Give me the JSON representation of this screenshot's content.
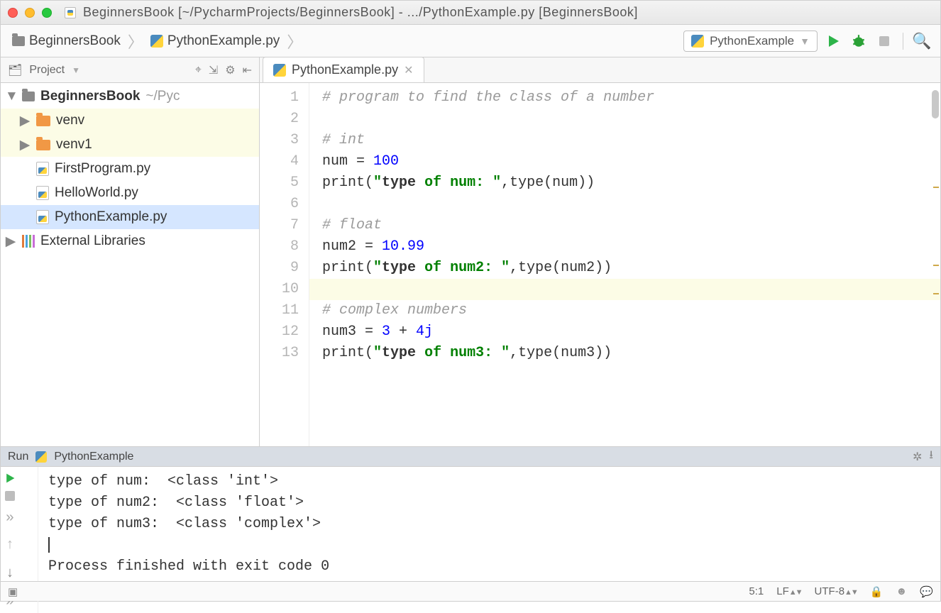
{
  "window": {
    "title": "BeginnersBook [~/PycharmProjects/BeginnersBook] - .../PythonExample.py [BeginnersBook]"
  },
  "breadcrumbs": {
    "root": "BeginnersBook",
    "file": "PythonExample.py"
  },
  "run_config": {
    "selected": "PythonExample"
  },
  "project_panel": {
    "label": "Project",
    "root": {
      "name": "BeginnersBook",
      "path": "~/Pyc"
    },
    "items": [
      {
        "type": "folder",
        "name": "venv",
        "selected": true
      },
      {
        "type": "folder",
        "name": "venv1",
        "selected": true
      },
      {
        "type": "pyfile",
        "name": "FirstProgram.py"
      },
      {
        "type": "pyfile",
        "name": "HelloWorld.py"
      },
      {
        "type": "pyfile",
        "name": "PythonExample.py",
        "highlight": true
      }
    ],
    "external": "External Libraries"
  },
  "editor": {
    "tab": {
      "name": "PythonExample.py"
    },
    "lines": [
      "# program to find the class of a number",
      "",
      "# int",
      "num = 100",
      "print(\"type of num: \",type(num))",
      "",
      "# float",
      "num2 = 10.99",
      "print(\"type of num2: \",type(num2))",
      "",
      "# complex numbers",
      "num3 = 3 + 4j",
      "print(\"type of num3: \",type(num3))"
    ],
    "current_line_index": 9
  },
  "run": {
    "title_prefix": "Run",
    "title": "PythonExample",
    "output": [
      "type of num:  <class 'int'>",
      "type of num2:  <class 'float'>",
      "type of num3:  <class 'complex'>",
      "",
      "Process finished with exit code 0"
    ]
  },
  "status": {
    "cursor": "5:1",
    "line_sep": "LF",
    "encoding": "UTF-8"
  }
}
